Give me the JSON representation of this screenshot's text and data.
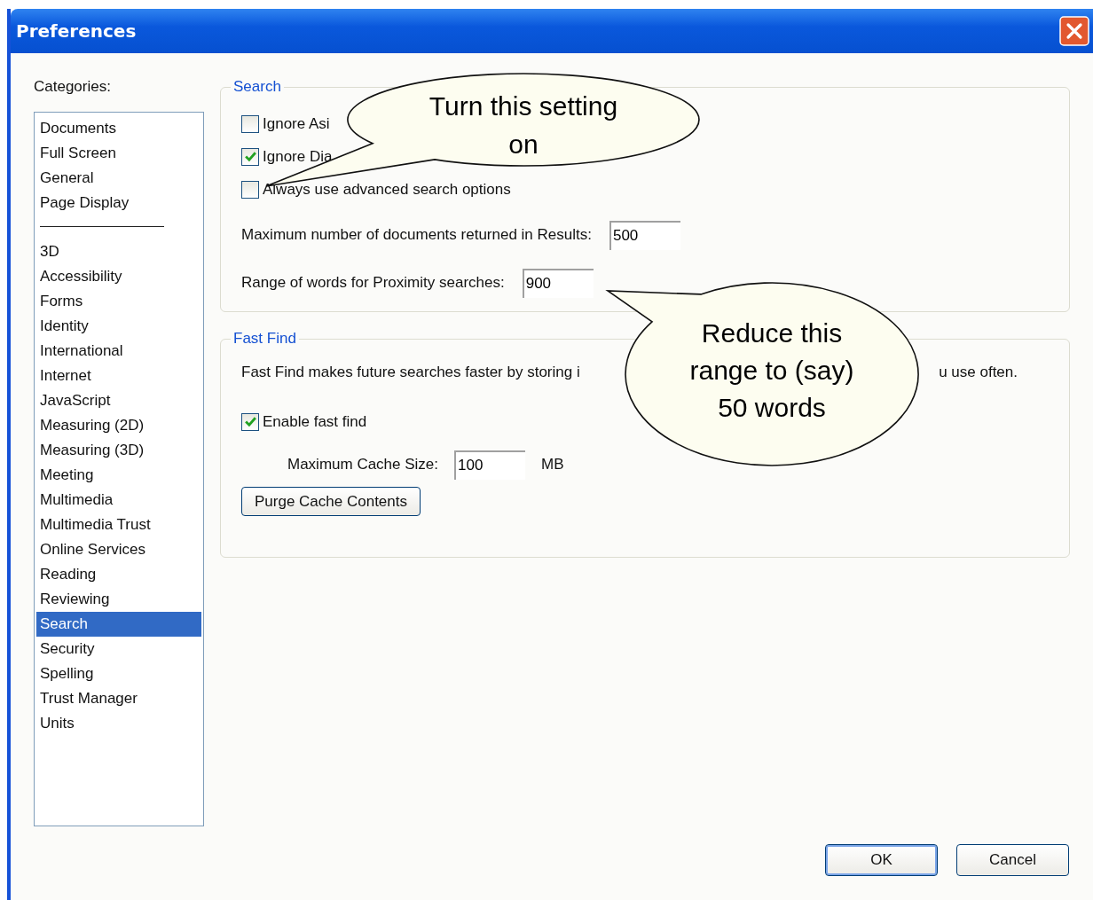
{
  "window": {
    "title": "Preferences"
  },
  "categories": {
    "label": "Categories:",
    "groups": [
      [
        {
          "label": "Documents",
          "selected": false
        },
        {
          "label": "Full Screen",
          "selected": false
        },
        {
          "label": "General",
          "selected": false
        },
        {
          "label": "Page Display",
          "selected": false
        }
      ],
      [
        {
          "label": "3D",
          "selected": false
        },
        {
          "label": "Accessibility",
          "selected": false
        },
        {
          "label": "Forms",
          "selected": false
        },
        {
          "label": "Identity",
          "selected": false
        },
        {
          "label": "International",
          "selected": false
        },
        {
          "label": "Internet",
          "selected": false
        },
        {
          "label": "JavaScript",
          "selected": false
        },
        {
          "label": "Measuring (2D)",
          "selected": false
        },
        {
          "label": "Measuring (3D)",
          "selected": false
        },
        {
          "label": "Meeting",
          "selected": false
        },
        {
          "label": "Multimedia",
          "selected": false
        },
        {
          "label": "Multimedia Trust",
          "selected": false
        },
        {
          "label": "Online Services",
          "selected": false
        },
        {
          "label": "Reading",
          "selected": false
        },
        {
          "label": "Reviewing",
          "selected": false
        },
        {
          "label": "Search",
          "selected": true
        },
        {
          "label": "Security",
          "selected": false
        },
        {
          "label": "Spelling",
          "selected": false
        },
        {
          "label": "Trust Manager",
          "selected": false
        },
        {
          "label": "Units",
          "selected": false
        }
      ]
    ]
  },
  "search": {
    "title": "Search",
    "checkboxes": [
      {
        "label": "Ignore Asi",
        "checked": false
      },
      {
        "label": "Ignore Dia",
        "checked": true
      },
      {
        "label": "Always use advanced search options",
        "checked": false
      }
    ],
    "fields": [
      {
        "label": "Maximum number of documents returned in Results:",
        "value": "500"
      },
      {
        "label": "Range of words for Proximity searches:",
        "value": "900"
      }
    ]
  },
  "fast_find": {
    "title": "Fast Find",
    "description_parts": [
      "Fast Find makes future searches faster by storing i",
      "u use often."
    ],
    "enable": {
      "label": "Enable fast find",
      "checked": true
    },
    "cache_size": {
      "label": "Maximum Cache Size:",
      "value": "100",
      "unit": "MB"
    },
    "purge_button": "Purge Cache Contents"
  },
  "buttons": [
    {
      "label": "OK",
      "default": true
    },
    {
      "label": "Cancel",
      "default": false
    }
  ],
  "callouts": [
    {
      "lines": [
        "Turn this setting",
        "on"
      ]
    },
    {
      "lines": [
        "Reduce this",
        "range to (say)",
        "50 words"
      ]
    }
  ]
}
